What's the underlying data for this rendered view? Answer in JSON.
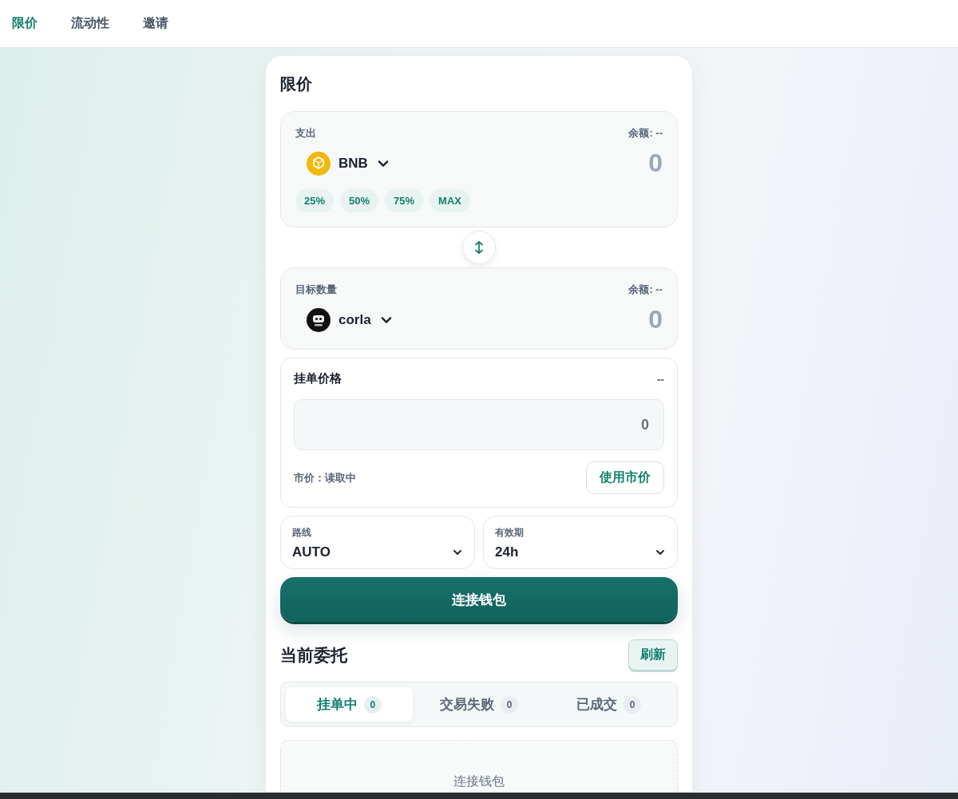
{
  "nav": {
    "items": [
      {
        "label": "限价",
        "selected": true
      },
      {
        "label": "流动性",
        "selected": false
      },
      {
        "label": "邀请",
        "selected": false
      }
    ]
  },
  "card": {
    "title": "限价",
    "pay": {
      "label": "支出",
      "balance": "余额: --",
      "token": "BNB",
      "kind": "bnb",
      "amount_placeholder": "0",
      "presets": [
        "25%",
        "50%",
        "75%",
        "MAX"
      ]
    },
    "receive": {
      "label": "目标数量",
      "balance": "余额: --",
      "token": "corla",
      "kind": "robot",
      "amount_placeholder": "0"
    },
    "price": {
      "label": "挂单价格",
      "value": "--",
      "input_placeholder": "0",
      "market_label": "市价：读取中",
      "use_market_button": "使用市价"
    },
    "selects": [
      {
        "label": "路线",
        "value": "AUTO"
      },
      {
        "label": "有效期",
        "value": "24h"
      }
    ],
    "connect_button": "连接钱包"
  },
  "orders": {
    "title": "当前委托",
    "refresh": "刷新",
    "tabs": [
      {
        "label": "挂单中",
        "count": "0",
        "selected": true
      },
      {
        "label": "交易失败",
        "count": "0",
        "selected": false
      },
      {
        "label": "已成交",
        "count": "0",
        "selected": false
      }
    ],
    "empty_text": "连接钱包"
  }
}
